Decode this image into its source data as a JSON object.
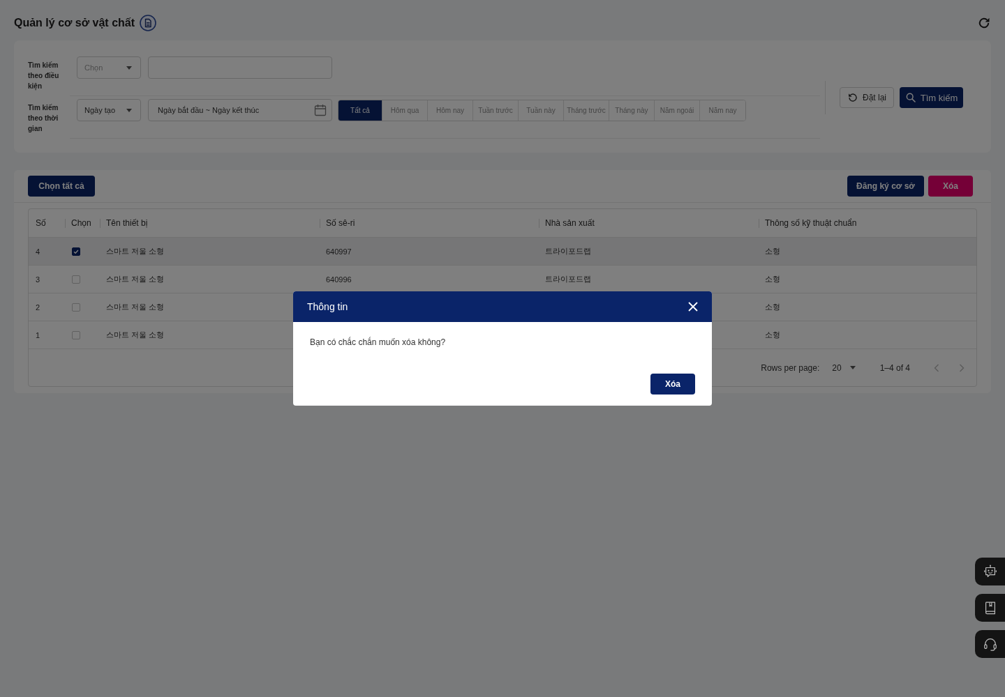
{
  "page": {
    "title": "Quản lý cơ sở vật chất"
  },
  "filters": {
    "condition": {
      "label": "Tìm kiếm theo điều kiện",
      "select": {
        "placeholder": "Chọn"
      }
    },
    "time": {
      "label": "Tìm kiếm theo thời gian",
      "select": {
        "value": "Ngày tạo"
      },
      "date_range": {
        "placeholder": "Ngày bắt đầu ~ Ngày kết thúc"
      },
      "periods": [
        {
          "label": "Tất cả",
          "selected": true
        },
        {
          "label": "Hôm qua",
          "selected": false
        },
        {
          "label": "Hôm nay",
          "selected": false
        },
        {
          "label": "Tuần trước",
          "selected": false
        },
        {
          "label": "Tuần này",
          "selected": false
        },
        {
          "label": "Tháng trước",
          "selected": false
        },
        {
          "label": "Tháng này",
          "selected": false
        },
        {
          "label": "Năm ngoái",
          "selected": false
        },
        {
          "label": "Năm nay",
          "selected": false
        }
      ]
    },
    "buttons": {
      "reset": "Đặt lại",
      "search": "Tìm kiếm"
    }
  },
  "toolbar": {
    "select_all": "Chọn tất cả",
    "register": "Đăng ký cơ sở",
    "delete": "Xóa"
  },
  "table": {
    "columns": [
      "Số",
      "Chọn",
      "Tên thiết bị",
      "Số sê-ri",
      "Nhà sản xuất",
      "Thông số kỹ thuật chuẩn"
    ],
    "rows": [
      {
        "number": "4",
        "checked": true,
        "device": "스마트 저울 소형",
        "serial": "640997",
        "manufacturer": "트라이포드랩",
        "spec": "소형"
      },
      {
        "number": "3",
        "checked": false,
        "device": "스마트 저울 소형",
        "serial": "640996",
        "manufacturer": "트라이포드랩",
        "spec": "소형"
      },
      {
        "number": "2",
        "checked": false,
        "device": "스마트 저울 소형",
        "spec": "소형"
      },
      {
        "number": "1",
        "checked": false,
        "device": "스마트 저울 소형",
        "spec": "소형"
      }
    ]
  },
  "pagination": {
    "rows_per_page_label": "Rows per page:",
    "rows_per_page": "20",
    "range": "1–4 of 4",
    "previous": {
      "disabled": true
    },
    "next": {
      "disabled": true
    }
  },
  "dialog": {
    "title": "Thông tin",
    "message": "Bạn có chắc chắn muốn xóa không?",
    "confirm": "Xóa"
  }
}
